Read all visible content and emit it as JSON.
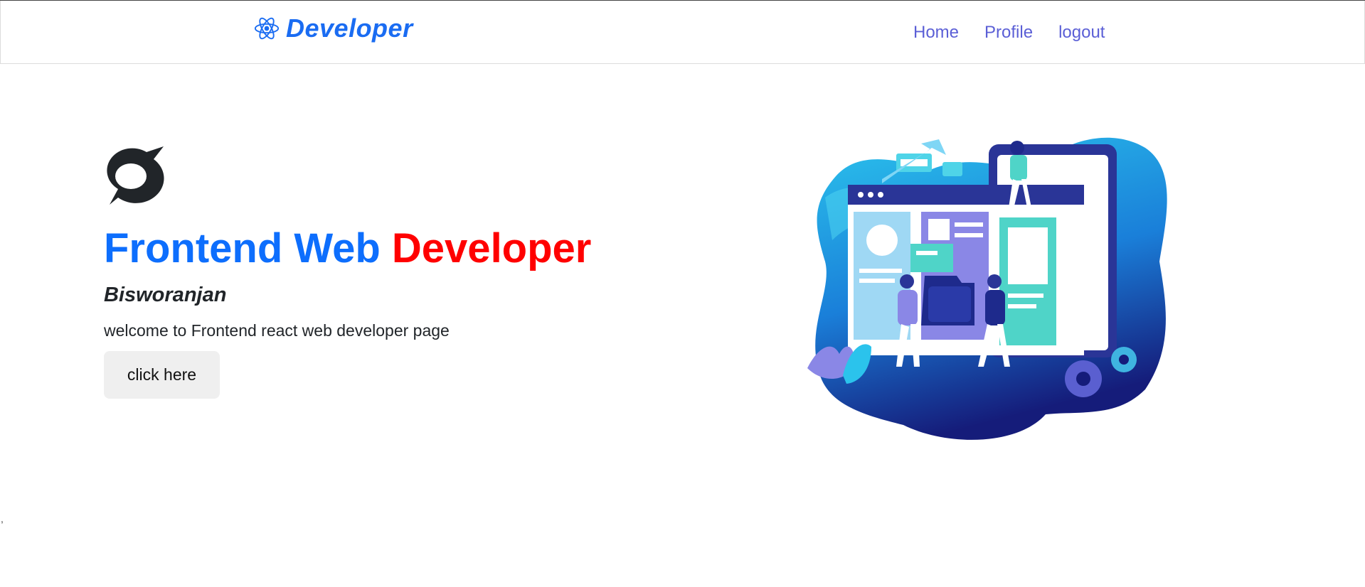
{
  "navbar": {
    "brand": "Developer",
    "brand_icon": "react-atom-icon",
    "links": [
      "Home",
      "Profile",
      "logout"
    ]
  },
  "hero": {
    "logo_icon": "speech-bubble-mark-icon",
    "title_part1": "Frontend Web",
    "title_part2": "Developer",
    "name": "Bisworanjan",
    "description": "welcome to Frontend react web developer page",
    "button": "click here",
    "illustration": "web-developer-team-illustration"
  },
  "stray_mark": ",",
  "colors": {
    "brand": "#1a6cf2",
    "nav_link": "#5b5fd6",
    "title_blue": "#0d6efd",
    "title_red": "#ff0000",
    "button_bg": "#efefef"
  }
}
